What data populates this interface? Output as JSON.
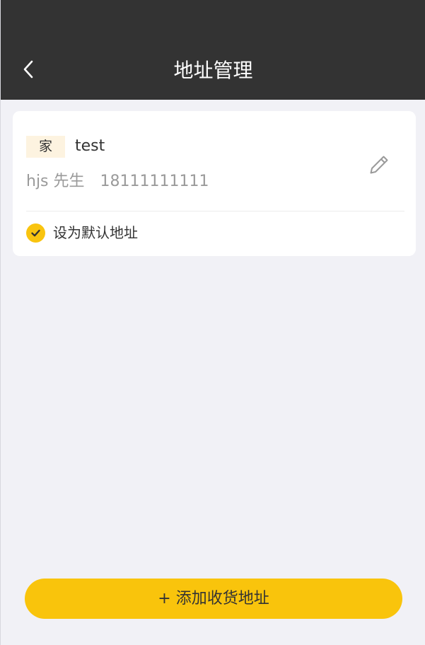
{
  "header": {
    "title": "地址管理",
    "back_icon": "chevron-left-icon"
  },
  "address_card": {
    "tag": "家",
    "address": "test",
    "name": "hjs 先生",
    "phone": "18111111111",
    "edit_icon": "pencil-icon",
    "default_label": "设为默认地址",
    "is_default": true
  },
  "footer": {
    "add_button_label": "+ 添加收货地址"
  },
  "colors": {
    "header_bg": "#333333",
    "page_bg": "#f1f1f6",
    "accent": "#f9c40c",
    "tag_bg": "#fdf3e0",
    "secondary_text": "#9a9a9a"
  }
}
